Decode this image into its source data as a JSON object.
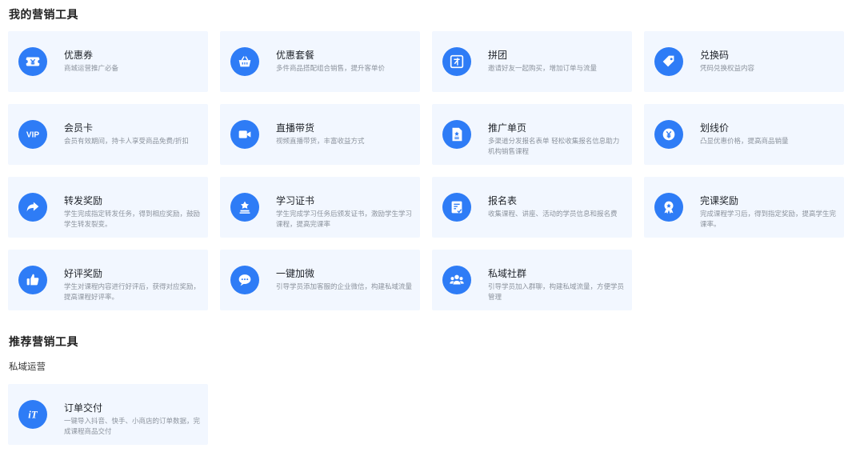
{
  "sections": {
    "my_tools_title": "我的营销工具",
    "recommended_title": "推荐营销工具",
    "private_ops_title": "私域运营"
  },
  "tools": [
    {
      "name": "优惠券",
      "desc": "商城运营推广必备",
      "icon": "coupon-icon"
    },
    {
      "name": "优惠套餐",
      "desc": "多件商品搭配组合销售，提升客单价",
      "icon": "basket-icon"
    },
    {
      "name": "拼团",
      "desc": "邀请好友一起购买，增加订单与流量",
      "icon": "group-buy-icon"
    },
    {
      "name": "兑换码",
      "desc": "凭码兑换权益内容",
      "icon": "tag-icon"
    },
    {
      "name": "会员卡",
      "desc": "会员有效期间，持卡人享受商品免费/折扣",
      "icon": "vip-icon"
    },
    {
      "name": "直播带货",
      "desc": "视频直播带货，丰富收益方式",
      "icon": "video-icon"
    },
    {
      "name": "推广单页",
      "desc": "多渠道分发报名表单 轻松收集报名信息助力机构销售课程",
      "icon": "document-icon"
    },
    {
      "name": "划线价",
      "desc": "凸显优惠价格，提高商品销量",
      "icon": "yen-icon"
    },
    {
      "name": "转发奖励",
      "desc": "学生完成指定转发任务，得到相应奖励，鼓励学生转发裂变。",
      "icon": "share-arrow-icon"
    },
    {
      "name": "学习证书",
      "desc": "学生完成学习任务后颁发证书，激励学生学习课程，提高完课率",
      "icon": "certificate-icon"
    },
    {
      "name": "报名表",
      "desc": "收集课程、讲座、活动的学员信息和报名费",
      "icon": "form-icon"
    },
    {
      "name": "完课奖励",
      "desc": "完成课程学习后，得到指定奖励，提高学生完课率。",
      "icon": "medal-icon"
    },
    {
      "name": "好评奖励",
      "desc": "学生对课程内容进行好评后，获得对应奖励，提高课程好评率。",
      "icon": "thumbs-up-icon"
    },
    {
      "name": "一键加微",
      "desc": "引导学员添加客服的企业微信，构建私域流量",
      "icon": "chat-icon"
    },
    {
      "name": "私域社群",
      "desc": "引导学员加入群聊，构建私域流量，方便学员管理",
      "icon": "community-icon"
    }
  ],
  "recommended_tools": [
    {
      "name": "订单交付",
      "desc": "一键导入抖音、快手、小商店的订单数据，完成课程商品交付",
      "icon": "it-icon"
    }
  ],
  "colors": {
    "accent": "#2e7cf6",
    "card_bg": "#f2f7ff",
    "desc": "#8c939d"
  }
}
